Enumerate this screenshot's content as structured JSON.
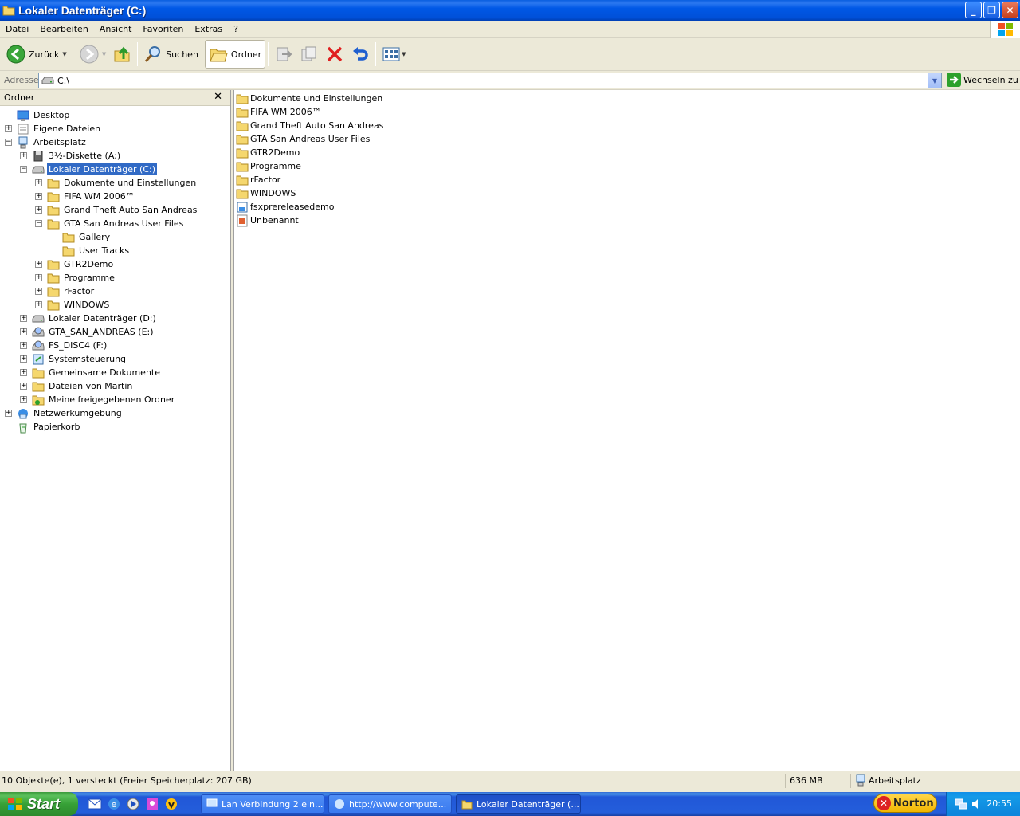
{
  "window": {
    "title": "Lokaler Datenträger (C:)"
  },
  "menu": [
    "Datei",
    "Bearbeiten",
    "Ansicht",
    "Favoriten",
    "Extras",
    "?"
  ],
  "toolbar": {
    "back": "Zurück",
    "search": "Suchen",
    "folders": "Ordner"
  },
  "address": {
    "label": "Adresse",
    "value": "C:\\",
    "go": "Wechseln zu"
  },
  "folderpane": {
    "title": "Ordner",
    "tree": [
      {
        "label": "Desktop",
        "icon": "desktop-icon"
      },
      {
        "label": "Eigene Dateien",
        "icon": "my-documents-icon"
      },
      {
        "label": "Arbeitsplatz",
        "icon": "my-computer-icon"
      },
      {
        "label": "3½-Diskette (A:)",
        "icon": "floppy-icon"
      },
      {
        "label": "Lokaler Datenträger (C:)",
        "icon": "hard-drive-icon"
      },
      {
        "label": "Dokumente und Einstellungen",
        "icon": "folder-icon"
      },
      {
        "label": "FIFA WM 2006™",
        "icon": "folder-icon"
      },
      {
        "label": "Grand Theft Auto San Andreas",
        "icon": "folder-icon"
      },
      {
        "label": "GTA San Andreas User Files",
        "icon": "folder-icon"
      },
      {
        "label": "Gallery",
        "icon": "folder-icon"
      },
      {
        "label": "User Tracks",
        "icon": "folder-icon"
      },
      {
        "label": "GTR2Demo",
        "icon": "folder-icon"
      },
      {
        "label": "Programme",
        "icon": "folder-icon"
      },
      {
        "label": "rFactor",
        "icon": "folder-icon"
      },
      {
        "label": "WINDOWS",
        "icon": "folder-icon"
      },
      {
        "label": "Lokaler Datenträger (D:)",
        "icon": "hard-drive-icon"
      },
      {
        "label": "GTA_SAN_ANDREAS (E:)",
        "icon": "cd-drive-icon"
      },
      {
        "label": "FS_DISC4 (F:)",
        "icon": "cd-drive-icon"
      },
      {
        "label": "Systemsteuerung",
        "icon": "control-panel-icon"
      },
      {
        "label": "Gemeinsame Dokumente",
        "icon": "folder-icon"
      },
      {
        "label": "Dateien von Martin",
        "icon": "folder-icon"
      },
      {
        "label": "Meine freigegebenen Ordner",
        "icon": "shared-folder-icon"
      },
      {
        "label": "Netzwerkumgebung",
        "icon": "network-icon"
      },
      {
        "label": "Papierkorb",
        "icon": "recycle-bin-icon"
      }
    ]
  },
  "files": [
    {
      "name": "Dokumente und Einstellungen",
      "icon": "folder-icon"
    },
    {
      "name": "FIFA WM 2006™",
      "icon": "folder-icon"
    },
    {
      "name": "Grand Theft Auto San Andreas",
      "icon": "folder-icon"
    },
    {
      "name": "GTA San Andreas User Files",
      "icon": "folder-icon"
    },
    {
      "name": "GTR2Demo",
      "icon": "folder-icon"
    },
    {
      "name": "Programme",
      "icon": "folder-icon"
    },
    {
      "name": "rFactor",
      "icon": "folder-icon"
    },
    {
      "name": "WINDOWS",
      "icon": "folder-icon"
    },
    {
      "name": "fsxprereleasedemo",
      "icon": "installer-icon"
    },
    {
      "name": "Unbenannt",
      "icon": "image-file-icon"
    }
  ],
  "status": {
    "objects": "10 Objekte(e), 1 versteckt (Freier Speicherplatz: 207 GB)",
    "size": "636 MB",
    "location": "Arbeitsplatz"
  },
  "taskbar": {
    "start": "Start",
    "tasks": [
      {
        "label": "Lan Verbindung 2 ein..."
      },
      {
        "label": "http://www.compute..."
      },
      {
        "label": "Lokaler Datenträger (..."
      }
    ],
    "norton": "Norton",
    "clock": "20:55"
  }
}
